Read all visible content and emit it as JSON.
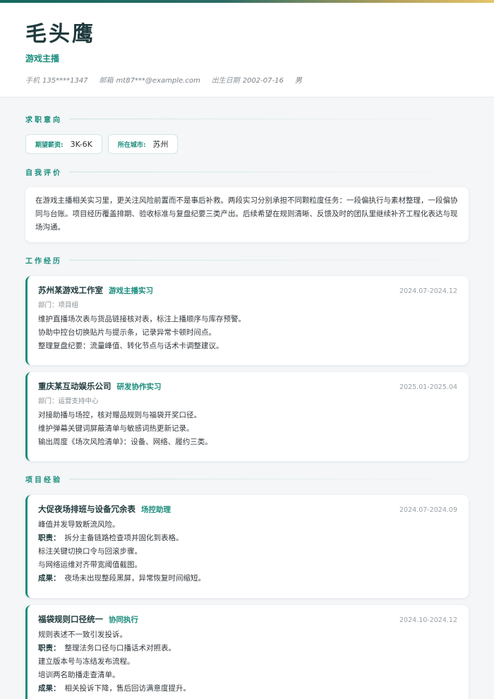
{
  "profile": {
    "name": "毛头鹰",
    "role": "游戏主播",
    "contacts": [
      {
        "label": "手机",
        "value": "135****1347"
      },
      {
        "label": "邮箱",
        "value": "mt87***@example.com"
      },
      {
        "label": "出生日期",
        "value": "2002-07-16"
      },
      {
        "label": "",
        "value": "男"
      }
    ]
  },
  "sections": {
    "intent": "求职意向",
    "summary": "自我评价",
    "work": "工作经历",
    "projects": "项目经验"
  },
  "intent": {
    "salary_label": "期望薪资:",
    "salary": "3K-6K",
    "city_label": "所在城市:",
    "city": "苏州"
  },
  "summary": {
    "text": "在游戏主播相关实习里，更关注风险前置而不是事后补救。两段实习分别承担不同颗粒度任务：一段偏执行与素材整理，一段偏协同与台账。项目经历覆盖排期、验收标准与复盘纪要三类产出。后续希望在规则清晰、反馈及时的团队里继续补齐工程化表达与现场沟通。"
  },
  "work": [
    {
      "org": "苏州某游戏工作室",
      "role": "游戏主播实习",
      "date": "2024.07-2024.12",
      "dept": "部门：项目组",
      "lines": [
        "维护直播场次表与货品链接核对表，标注上播顺序与库存预警。",
        "协助中控台切换贴片与提示条，记录异常卡顿时间点。",
        "整理复盘纪要：流量峰值、转化节点与话术卡调整建议。"
      ]
    },
    {
      "org": "重庆某互动娱乐公司",
      "role": "研发协作实习",
      "date": "2025.01-2025.04",
      "dept": "部门：运营支持中心",
      "lines": [
        "对接助播与场控，核对赠品规则与福袋开奖口径。",
        "维护弹幕关键词屏蔽清单与敏感词热更新记录。",
        "输出周度《场次风险清单》：设备、网络、履约三类。"
      ]
    }
  ],
  "projects": [
    {
      "name": "大促夜场排班与设备冗余表",
      "role": "场控助理",
      "date": "2024.07-2024.09",
      "intro": "峰值并发导致断流风险。",
      "duty_label": "职责：",
      "duties": [
        "拆分主备链路检查项并固化到表格。",
        "标注关键切换口令与回滚步骤。",
        "与网络运维对齐带宽阈值截图。"
      ],
      "result_label": "成果：",
      "result": "夜场未出现整段黑屏，异常恢复时间缩短。"
    },
    {
      "name": "福袋规则口径统一",
      "role": "协同执行",
      "date": "2024.10-2024.12",
      "intro": "规则表述不一致引发投诉。",
      "duty_label": "职责：",
      "duties": [
        "整理法务口径与口播话术对照表。",
        "建立版本号与冻结发布流程。",
        "培训两名助播走查清单。"
      ],
      "result_label": "成果：",
      "result": "相关投诉下降，售后回访满意度提升。"
    }
  ]
}
